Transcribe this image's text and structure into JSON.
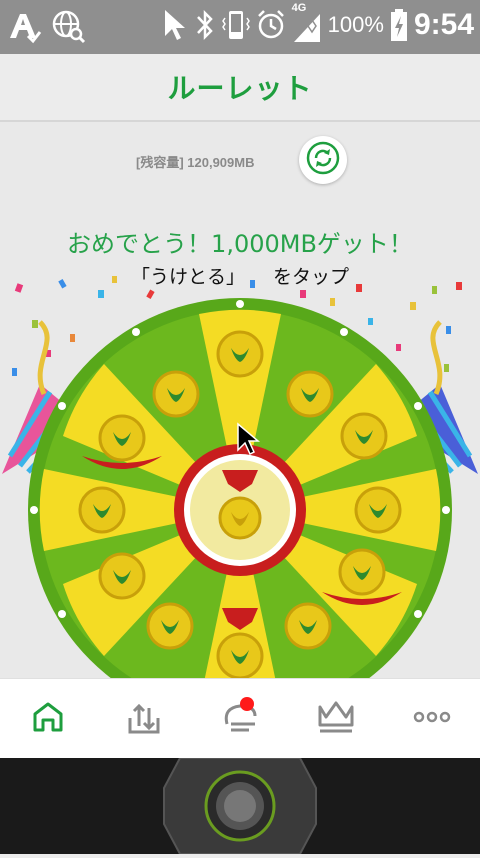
{
  "status_bar": {
    "battery": "100%",
    "network": "4G",
    "time": "9:54",
    "icons": [
      "accessibility-icon",
      "globe-search-icon",
      "cursor-icon",
      "bluetooth-icon",
      "phone-vibrate-icon",
      "alarm-icon",
      "signal-icon",
      "battery-charging-icon"
    ]
  },
  "header": {
    "title": "ルーレット"
  },
  "main": {
    "capacity_label": "[残容量] 120,909MB",
    "congrats": "おめでとう！1,000MBゲット！",
    "instruction_left": "「うけとる」",
    "instruction_right": "をタップ"
  },
  "bottom_nav": {
    "items": [
      "home-icon",
      "upload-tray-icon",
      "chat-icon",
      "crown-icon",
      "more-icon"
    ],
    "active": "home-icon",
    "badge_on": "chat-icon"
  },
  "colors": {
    "brand_green": "#1e9e3e",
    "wheel_green": "#6cb81e",
    "wheel_yellow": "#f4dc24",
    "accent_red": "#c81e1e"
  }
}
